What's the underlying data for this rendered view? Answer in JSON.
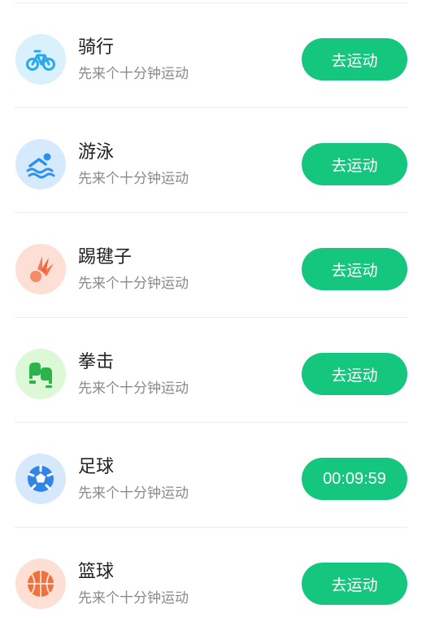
{
  "items": [
    {
      "title": "骑行",
      "subtitle": "先来个十分钟运动",
      "action": "去运动",
      "icon": "bicycle-icon",
      "icon_bg": "#d9f0fd",
      "icon_color": "#2aa8ee"
    },
    {
      "title": "游泳",
      "subtitle": "先来个十分钟运动",
      "action": "去运动",
      "icon": "swimming-icon",
      "icon_bg": "#d6eafe",
      "icon_color": "#2b90ef"
    },
    {
      "title": "踢毽子",
      "subtitle": "先来个十分钟运动",
      "action": "去运动",
      "icon": "shuttlecock-icon",
      "icon_bg": "#fddfd6",
      "icon_color": "#f2673c"
    },
    {
      "title": "拳击",
      "subtitle": "先来个十分钟运动",
      "action": "去运动",
      "icon": "boxing-glove-icon",
      "icon_bg": "#dcf8d6",
      "icon_color": "#2cb34a"
    },
    {
      "title": "足球",
      "subtitle": "先来个十分钟运动",
      "action": "00:09:59",
      "icon": "soccer-ball-icon",
      "icon_bg": "#d6e8fb",
      "icon_color": "#2f86e6"
    },
    {
      "title": "篮球",
      "subtitle": "先来个十分钟运动",
      "action": "去运动",
      "icon": "basketball-icon",
      "icon_bg": "#fddfd3",
      "icon_color": "#f0703e"
    }
  ],
  "colors": {
    "accent": "#15c67e",
    "title_text": "#222222",
    "subtitle_text": "#8a8a8a",
    "divider": "#ececec"
  }
}
